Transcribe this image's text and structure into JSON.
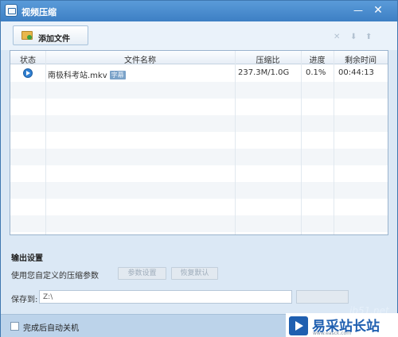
{
  "window": {
    "title": "视频压缩",
    "minimize_glyph": "—",
    "close_glyph": "✕"
  },
  "toolbar": {
    "add_file_label": "添加文件",
    "icons": [
      "folder-add-icon",
      "delete-icon",
      "move-down-icon",
      "move-up-icon"
    ]
  },
  "table": {
    "columns": [
      "状态",
      "文件名称",
      "压缩比",
      "进度",
      "剩余时间"
    ],
    "rows": [
      {
        "status": "play-icon",
        "name": "南极科考站.mkv",
        "badge": "字幕",
        "ratio": "237.3M/1.0G",
        "progress": "0.1%",
        "remaining": "00:44:13"
      }
    ]
  },
  "output": {
    "title": "输出设置",
    "description": "使用您自定义的压缩参数",
    "params_button": "参数设置",
    "restore_button": "恢复默认",
    "save_label": "保存到:",
    "save_path": "Z:\\"
  },
  "footer": {
    "shutdown_label": "完成后自动关机",
    "shutdown_checked": false
  },
  "watermark": {
    "site": "jb51.net",
    "brand": "易采站长站",
    "sub": "www.easck.com"
  },
  "colors": {
    "titlebar": "#3d7fc4",
    "window_bg": "#dbe8f5",
    "footer_bg": "#bcd3ea",
    "status_icon": "#2f7fd1"
  }
}
